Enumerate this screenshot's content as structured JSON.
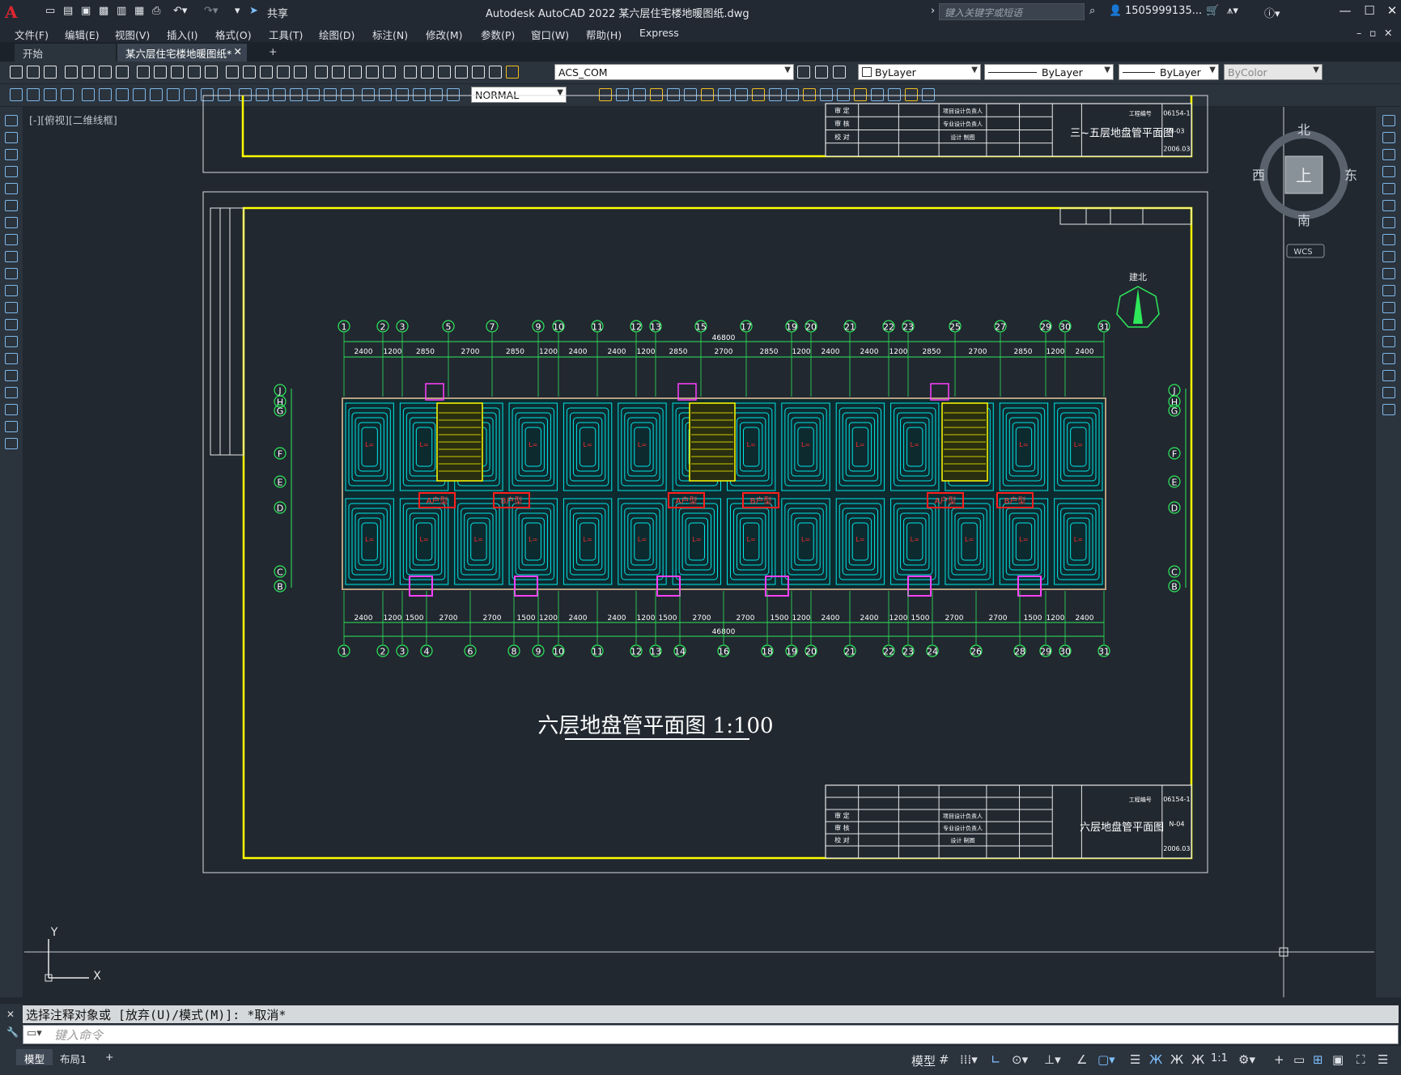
{
  "app": {
    "logo": "A",
    "title": "Autodesk AutoCAD 2022    某六层住宅楼地暖图纸.dwg",
    "share_label": "共享",
    "search_placeholder": "键入关键字或短语",
    "user": "1505999135...",
    "colors": {
      "accent_logo": "#e0252f",
      "drawing_frame": "#ffff00",
      "pipe": "#00e5e5",
      "annotation": "#ff2020"
    }
  },
  "menu": [
    "文件(F)",
    "编辑(E)",
    "视图(V)",
    "插入(I)",
    "格式(O)",
    "工具(T)",
    "绘图(D)",
    "标注(N)",
    "修改(M)",
    "参数(P)",
    "窗口(W)",
    "帮助(H)",
    "Express"
  ],
  "tabs": [
    {
      "label": "开始"
    },
    {
      "label": "某六层住宅楼地暖图纸*"
    }
  ],
  "toolbar": {
    "layer": "ACS_COM",
    "color": "ByLayer",
    "linetype": "ByLayer",
    "lineweight": "ByLayer",
    "plotstyle": "ByColor",
    "dimstyle": "NORMAL"
  },
  "viewport": {
    "view_label": "[-][俯视][二维线框]",
    "compass": {
      "north": "北",
      "south": "南",
      "east": "东",
      "west": "西",
      "top": "上",
      "wcs": "WCS"
    },
    "ucs": {
      "x": "X",
      "y": "Y"
    }
  },
  "drawing": {
    "north_label": "建北",
    "plan_title": "六层地盘管平面图 1:100",
    "upper_titleblock_name": "三~五层地盘管平面图",
    "upper_titleblock_no": "N-03",
    "lower_titleblock_name": "六层地盘管平面图",
    "lower_titleblock_no": "N-04",
    "titleblock_project_no": "工程编号",
    "titleblock_project_value": "06154-1",
    "titleblock_date": "2006.03",
    "titleblock_labels": [
      "审 定",
      "审 核",
      "校 对",
      "项目设计负责人",
      "专业设计负责人",
      "设计 制图"
    ],
    "top_axes": [
      "1",
      "2",
      "3",
      "5",
      "7",
      "9",
      "10",
      "11",
      "12",
      "13",
      "15",
      "17",
      "19",
      "20",
      "21",
      "22",
      "23",
      "25",
      "27",
      "29",
      "30",
      "31"
    ],
    "bottom_axes": [
      "1",
      "2",
      "3",
      "4",
      "6",
      "8",
      "9",
      "10",
      "11",
      "12",
      "13",
      "14",
      "16",
      "18",
      "19",
      "20",
      "21",
      "22",
      "23",
      "24",
      "26",
      "28",
      "29",
      "30",
      "31"
    ],
    "top_dims": [
      "2400",
      "1200",
      "2850",
      "2700",
      "2850",
      "1200",
      "2400",
      "2400",
      "1200",
      "2850",
      "2700",
      "2850",
      "1200",
      "2400",
      "2400",
      "1200",
      "2850",
      "2700",
      "2850",
      "1200",
      "2400"
    ],
    "bottom_dims": [
      "2400",
      "1200",
      "1500",
      "2700",
      "2700",
      "1500",
      "1200",
      "2400",
      "2400",
      "1200",
      "1500",
      "2700",
      "2700",
      "1500",
      "1200",
      "2400",
      "2400",
      "1200",
      "1500",
      "2700",
      "2700",
      "1500",
      "1200",
      "2400"
    ],
    "total_dim": "46800",
    "row_axes": [
      "J",
      "H",
      "G",
      "F",
      "E",
      "D",
      "C",
      "B"
    ],
    "unit_labels": [
      "A户型",
      "B户型",
      "A户型",
      "B户型",
      "A户型",
      "B户型"
    ]
  },
  "command": {
    "history": "选择注释对象或 [放弃(U)/模式(M)]: *取消*",
    "placeholder": "键入命令"
  },
  "status": {
    "tabs": [
      "模型",
      "布局1"
    ],
    "scale": "1:1"
  }
}
